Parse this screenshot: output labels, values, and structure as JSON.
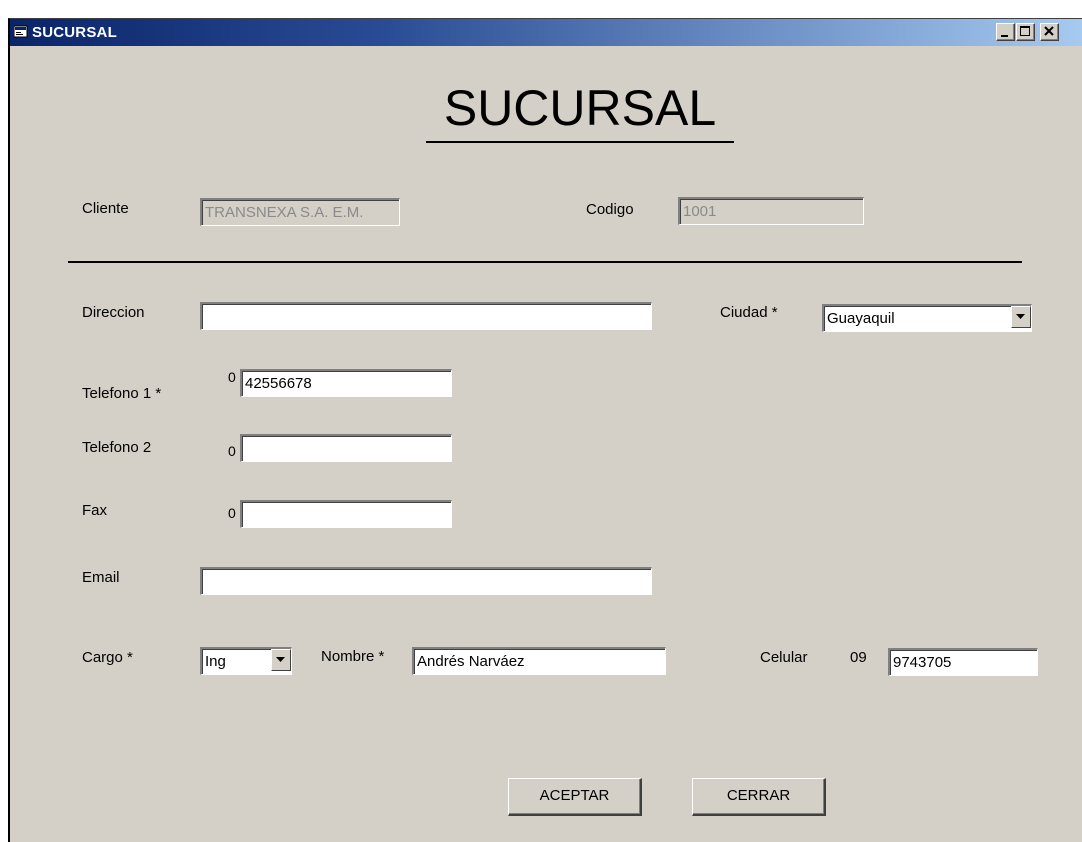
{
  "window": {
    "title": "SUCURSAL"
  },
  "form": {
    "heading": "SUCURSAL",
    "cliente": {
      "label": "Cliente",
      "value": "TRANSNEXA S.A. E.M."
    },
    "codigo": {
      "label": "Codigo",
      "value": "1001"
    },
    "direccion": {
      "label": "Direccion",
      "value": ""
    },
    "ciudad": {
      "label": "Ciudad *",
      "value": "Guayaquil"
    },
    "telefono1": {
      "label": "Telefono 1 *",
      "prefix": "0",
      "value": "42556678"
    },
    "telefono2": {
      "label": "Telefono 2",
      "prefix": "0",
      "value": ""
    },
    "fax": {
      "label": "Fax",
      "prefix": "0",
      "value": ""
    },
    "email": {
      "label": "Email",
      "value": ""
    },
    "cargo": {
      "label": "Cargo *",
      "value": "Ing"
    },
    "nombre": {
      "label": "Nombre *",
      "value": "Andrés Narváez"
    },
    "celular": {
      "label": "Celular",
      "prefix": "09",
      "value": "9743705"
    }
  },
  "buttons": {
    "accept": "ACEPTAR",
    "close": "CERRAR"
  }
}
